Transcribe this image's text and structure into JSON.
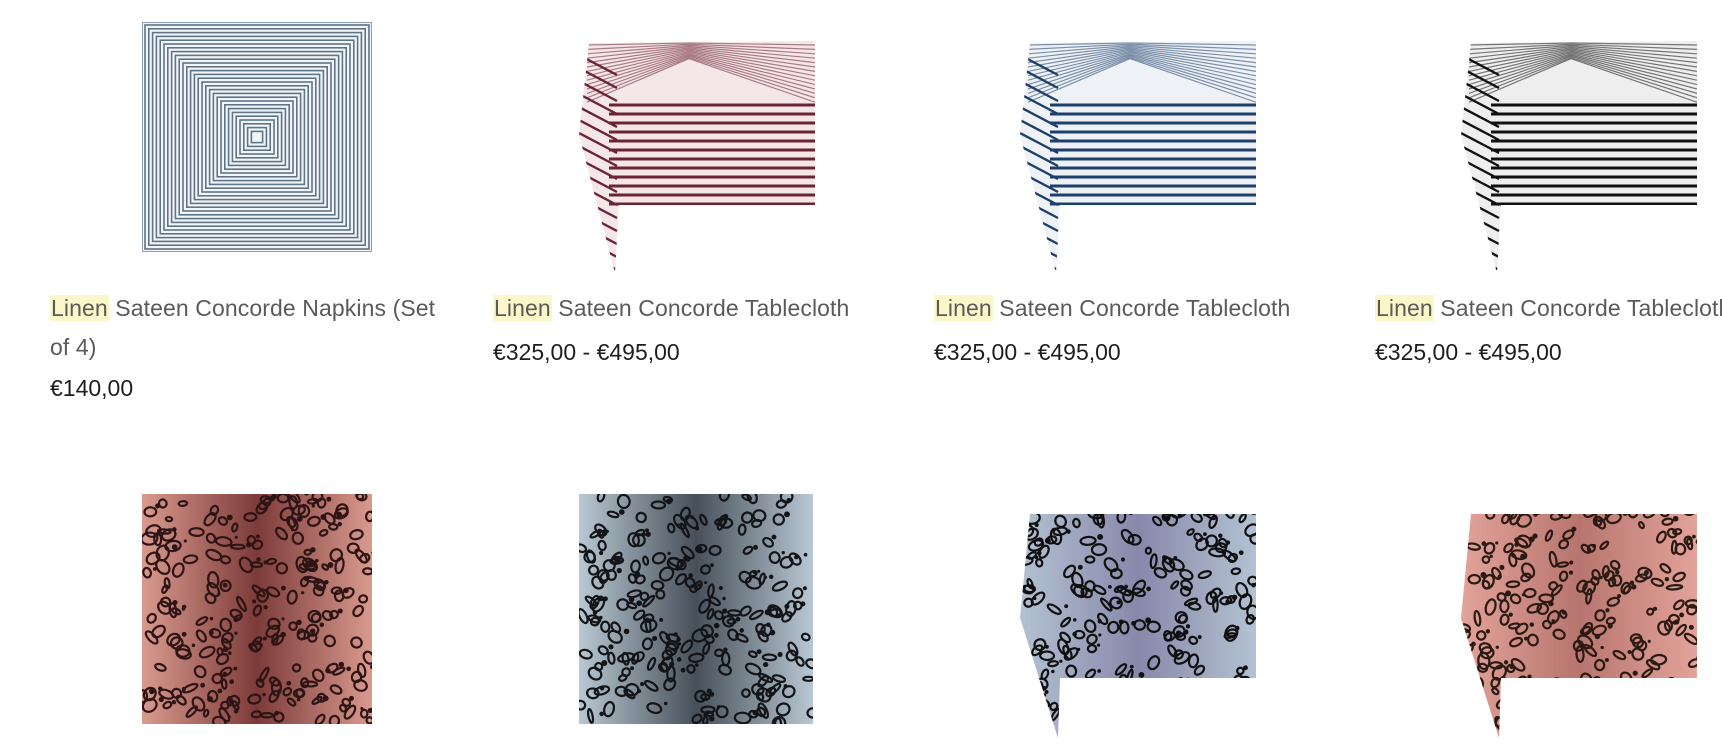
{
  "search": {
    "highlight_term": "Linen"
  },
  "products": [
    {
      "highlight": "Linen",
      "name": "Sateen Concorde Napkins (Set of 4)",
      "price": "€140,00",
      "icon": "concentric-stripe-napkin-image",
      "colors": {
        "stripe": "#5f7587",
        "ground": "#f3f6f8"
      }
    },
    {
      "highlight": "Linen",
      "name": "Sateen Concorde Tablecloth",
      "price": "€325,00 - €495,00",
      "icon": "red-striped-tablecloth-image",
      "colors": {
        "stripe": "#6b2434",
        "ground": "#f5e6e7"
      }
    },
    {
      "highlight": "Linen",
      "name": "Sateen Concorde Tablecloth",
      "price": "€325,00 - €495,00",
      "icon": "blue-striped-tablecloth-image",
      "colors": {
        "stripe": "#1f3f6b",
        "ground": "#eef2f7"
      }
    },
    {
      "highlight": "Linen",
      "name": "Sateen Concorde Tablecloth",
      "price": "€325,00 - €495,00",
      "icon": "black-striped-tablecloth-image",
      "colors": {
        "stripe": "#111111",
        "ground": "#eeeeee"
      }
    },
    {
      "highlight": "",
      "name": "",
      "price": "",
      "icon": "pink-leopard-napkin-image",
      "colors": {
        "ground": "#d99a8e",
        "spot": "#2e1414",
        "center": "#7c3b39"
      }
    },
    {
      "highlight": "",
      "name": "",
      "price": "",
      "icon": "grey-leopard-napkin-image",
      "colors": {
        "ground": "#b9c8d3",
        "spot": "#121417",
        "center": "#46505a"
      }
    },
    {
      "highlight": "",
      "name": "",
      "price": "",
      "icon": "blue-leopard-tablecloth-image",
      "colors": {
        "ground": "#b3c2d2",
        "spot": "#101010",
        "center": "#88a"
      }
    },
    {
      "highlight": "",
      "name": "",
      "price": "",
      "icon": "pink-leopard-tablecloth-image",
      "colors": {
        "ground": "#e2a39a",
        "spot": "#2a1a12",
        "center": "#b8756f"
      }
    }
  ]
}
